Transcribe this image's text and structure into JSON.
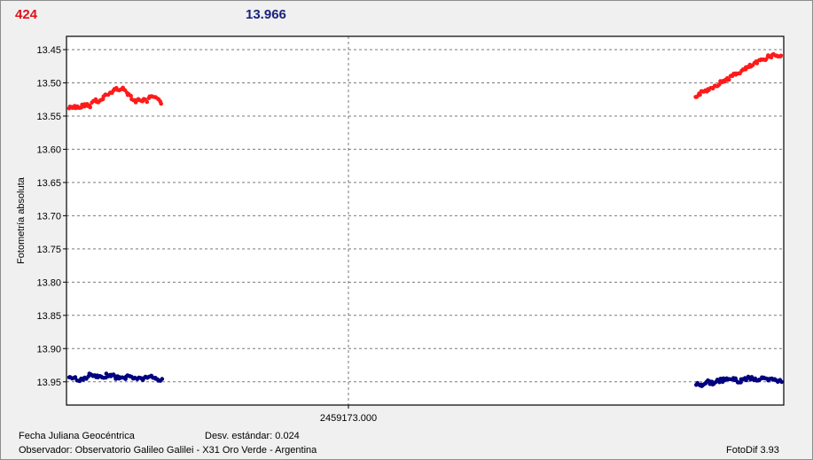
{
  "header": {
    "point_count": "424",
    "mean_value": "13.966"
  },
  "footer": {
    "date_label": "Fecha Juliana Geocéntrica",
    "stddev_label": "Desv. estándar: 0.024",
    "observer_label": "Observador: Observatorio Galileo Galilei - X31 Oro Verde - Argentina",
    "software_label": "FotoDif 3.93"
  },
  "colors": {
    "target": "#ff1a1a",
    "comparison": "#000080",
    "count_text": "#e0101a",
    "mean_text": "#1a237e"
  },
  "chart_data": {
    "type": "scatter",
    "ylabel": "Fotometría absoluta",
    "xlabel": "",
    "y_inverted": true,
    "ylim": [
      13.43,
      13.985
    ],
    "y_ticks": [
      "13.45",
      "13.50",
      "13.55",
      "13.60",
      "13.65",
      "13.70",
      "13.75",
      "13.80",
      "13.85",
      "13.90",
      "13.95"
    ],
    "x_ticks": [
      "2459173.000"
    ],
    "grid": "dashed",
    "segments": [
      {
        "series": "target",
        "x": [
          0.0,
          0.13
        ],
        "y": [
          13.538,
          13.535,
          13.54,
          13.532,
          13.536,
          13.525,
          13.528,
          13.52,
          13.515,
          13.51,
          13.508,
          13.512,
          13.52,
          13.528,
          13.525,
          13.528,
          13.52,
          13.525,
          13.53
        ]
      },
      {
        "series": "target",
        "x": [
          0.88,
          1.0
        ],
        "y": [
          13.52,
          13.515,
          13.51,
          13.505,
          13.5,
          13.495,
          13.49,
          13.485,
          13.48,
          13.475,
          13.47,
          13.465,
          13.46,
          13.458,
          13.46
        ]
      },
      {
        "series": "comparison",
        "x": [
          0.0,
          0.13
        ],
        "y": [
          13.943,
          13.945,
          13.948,
          13.94,
          13.942,
          13.945,
          13.938,
          13.943,
          13.945,
          13.942,
          13.944,
          13.946,
          13.942,
          13.945,
          13.948
        ]
      },
      {
        "series": "comparison",
        "x": [
          0.88,
          1.0
        ],
        "y": [
          13.953,
          13.955,
          13.95,
          13.952,
          13.948,
          13.947,
          13.945,
          13.95,
          13.946,
          13.944,
          13.947,
          13.945,
          13.948,
          13.946,
          13.95
        ]
      }
    ]
  }
}
